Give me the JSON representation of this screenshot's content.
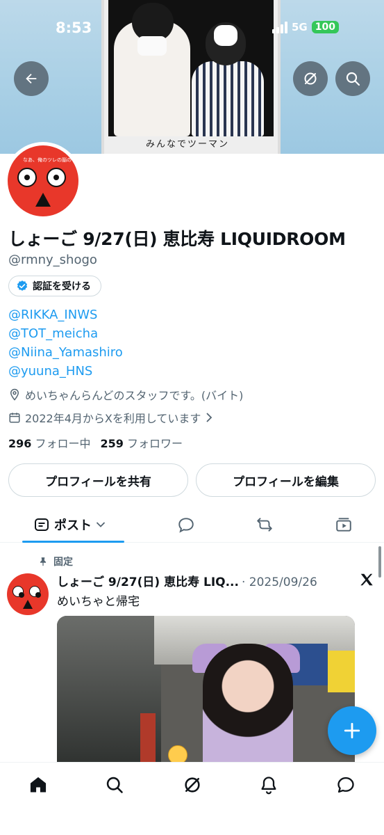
{
  "status_bar": {
    "time": "8:53",
    "network": "5G",
    "battery": "100"
  },
  "banner": {
    "photo_caption": "みんなでツーマン"
  },
  "avatar": {
    "text": "なあ、俺のツレの脳のヤツ見なかった？"
  },
  "profile": {
    "display_name": "しょーご 9/27(日) 恵比寿 LIQUIDROOM",
    "handle": "@rmny_shogo",
    "verify_label": "認証を受ける",
    "bio_links": [
      "@RIKKA_INWS",
      "@TOT_meicha",
      "@Niina_Yamashiro",
      "@yuuna_HNS"
    ],
    "location": "めいちゃんらんどのスタッフです。(バイト)",
    "joined": "2022年4月からXを利用しています",
    "following_count": "296",
    "following_label": "フォロー中",
    "followers_count": "259",
    "followers_label": "フォロワー",
    "share_button": "プロフィールを共有",
    "edit_button": "プロフィールを編集"
  },
  "tabs": {
    "posts_label": "ポスト"
  },
  "post": {
    "pinned_label": "固定",
    "author": "しょーご 9/27(日) 恵比寿 LIQ...",
    "date": "· 2025/09/26",
    "text": "めいちゃと帰宅"
  },
  "icons": {
    "back": "back-arrow-icon",
    "grok": "grok-icon",
    "search": "search-icon",
    "verified": "verified-badge-icon",
    "location": "location-pin-icon",
    "calendar": "calendar-icon",
    "pin": "pin-icon",
    "x_logo": "x-logo-icon",
    "compose": "plus-icon"
  },
  "colors": {
    "accent": "#1d9bf0",
    "text": "#0f1419",
    "muted": "#536471",
    "avatar_red": "#e8372a"
  }
}
